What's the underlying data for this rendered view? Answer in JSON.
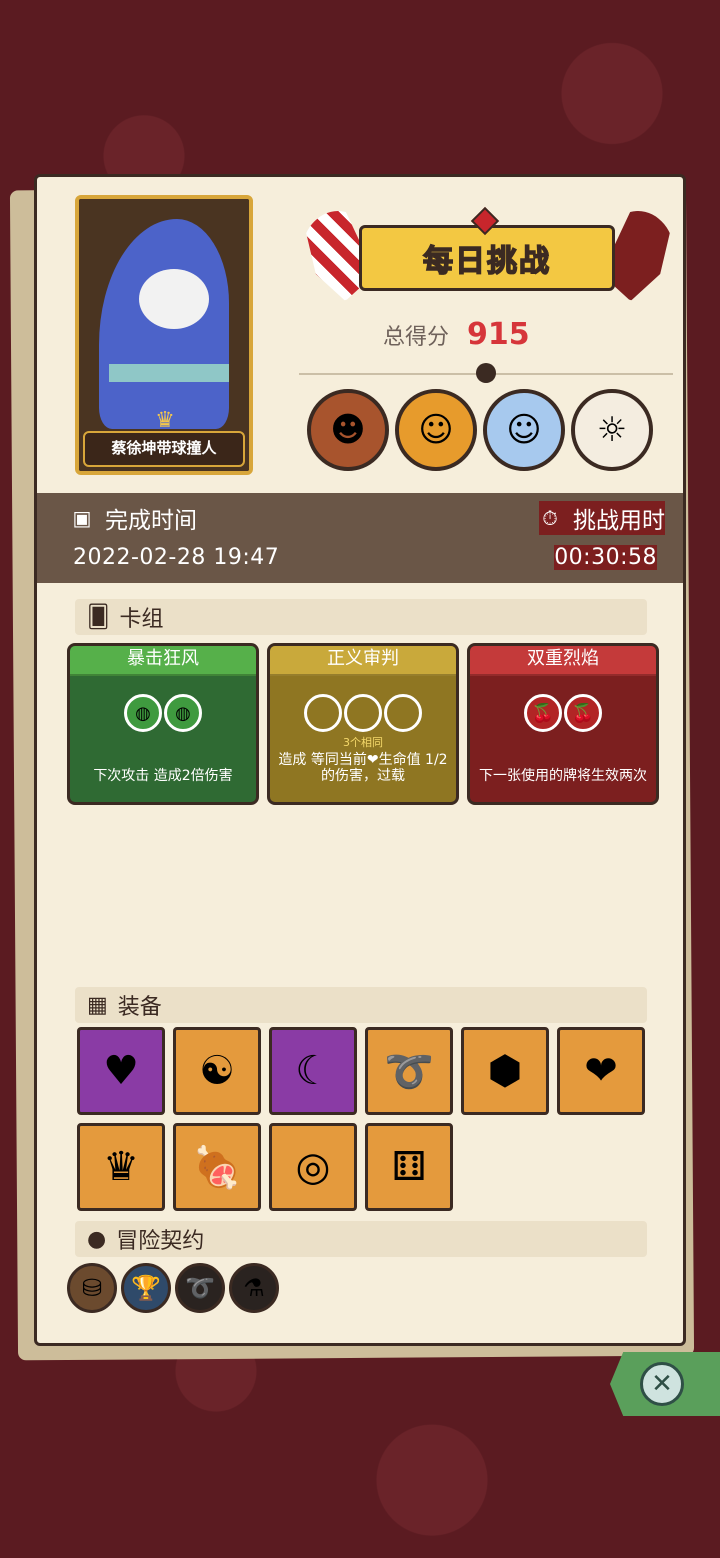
{
  "hero": {
    "name": "蔡徐坤带球撞人"
  },
  "header": {
    "title": "每日挑战",
    "score_label": "总得分",
    "score": "915"
  },
  "opponents": [
    "opponent-1",
    "opponent-2",
    "opponent-3",
    "opponent-4"
  ],
  "time": {
    "finish_label": "完成时间",
    "finish_value": "2022-02-28 19:47",
    "duration_label": "挑战用时",
    "duration_value": "00:30:58"
  },
  "deck": {
    "section_label": "卡组",
    "cards": [
      {
        "title": "暴击狂风",
        "note": "",
        "desc": "下次攻击 造成2倍伤害",
        "color": "#56b04a"
      },
      {
        "title": "正义审判",
        "note": "3个相同",
        "desc": "造成 等同当前❤生命值 1/2 的伤害，过载",
        "color": "#c9a93b"
      },
      {
        "title": "双重烈焰",
        "note": "",
        "desc": "下一张使用的牌将生效两次",
        "color": "#c43a3a"
      }
    ]
  },
  "equipment": {
    "section_label": "装备"
  },
  "contract": {
    "section_label": "冒险契约"
  },
  "close": {
    "icon": "close-icon"
  }
}
